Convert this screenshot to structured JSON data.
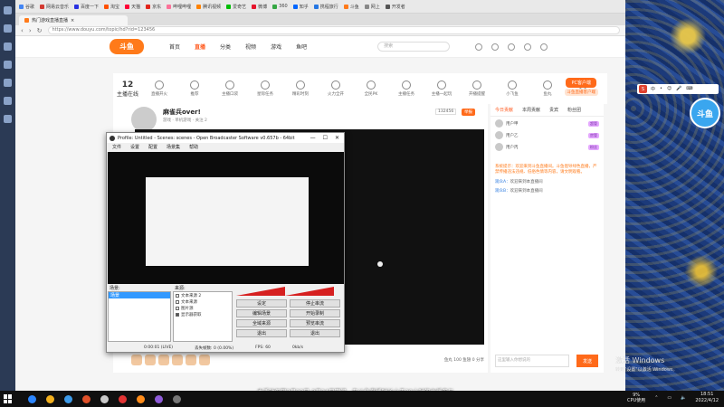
{
  "bookmarks": [
    {
      "label": "谷歌",
      "color": "#4285f4"
    },
    {
      "label": "网易云音乐",
      "color": "#d33a31"
    },
    {
      "label": "百度一下",
      "color": "#2932e1"
    },
    {
      "label": "淘宝",
      "color": "#ff5000"
    },
    {
      "label": "天猫",
      "color": "#ff0036"
    },
    {
      "label": "京东",
      "color": "#e1251b"
    },
    {
      "label": "哔哩哔哩",
      "color": "#fb7299"
    },
    {
      "label": "腾讯视频",
      "color": "#ff8200"
    },
    {
      "label": "爱奇艺",
      "color": "#00be06"
    },
    {
      "label": "微博",
      "color": "#e6162d"
    },
    {
      "label": "360",
      "color": "#35a743"
    },
    {
      "label": "知乎",
      "color": "#0066ff"
    },
    {
      "label": "携程旅行",
      "color": "#2577e3"
    },
    {
      "label": "斗鱼",
      "color": "#ff7a1a"
    },
    {
      "label": "网上",
      "color": "#888888"
    },
    {
      "label": "开发者",
      "color": "#555555"
    }
  ],
  "tab": {
    "title": "热门游戏直播直播"
  },
  "address": {
    "url": "https://www.douyu.com/topic/hd?rid=123456"
  },
  "site": {
    "logo": "斗鱼",
    "nav": [
      "首页",
      "直播",
      "分类",
      "视频",
      "游戏",
      "鱼吧"
    ],
    "active_nav": "直播",
    "search_placeholder": "搜索"
  },
  "category_strip": {
    "follow_count": "12",
    "follow_label": "主播在线",
    "items": [
      "直播开火",
      "推荐",
      "主播口袋",
      "星际任务",
      "精彩时刻",
      "火力全开",
      "全民PK",
      "主播任务",
      "主播一起玩",
      "开播提醒",
      "小飞鱼",
      "鱼丸",
      "更多"
    ],
    "pc_button": "PC客户端",
    "pc_sub": "斗鱼直播客户端"
  },
  "room": {
    "title": "麻雀兵over!",
    "meta": "游戏 · 单机游戏 · 关注 2",
    "room_id": "132456",
    "report": "举报",
    "gift_bar_text": "鱼丸 100  鱼翅 0  分享"
  },
  "chat": {
    "tabs": [
      "今日贡献",
      "本周贡献",
      "贵宾",
      "粉丝团"
    ],
    "active_tab": "今日贡献",
    "rank": [
      {
        "name": "用户甲",
        "badge": "超管"
      },
      {
        "name": "用户乙",
        "badge": "房管"
      },
      {
        "name": "用户丙",
        "badge": "粉丝"
      }
    ],
    "notice": "系统提示：欢迎来到斗鱼直播间。斗鱼倡导绿色直播，严禁传播违法违规、低俗色情等内容，请文明观看。",
    "lines": [
      {
        "user": "观众A",
        "text": "欢迎来到本直播间"
      },
      {
        "user": "观众B",
        "text": "欢迎来到本直播间"
      }
    ],
    "input_placeholder": "这里输入你想说的",
    "send": "发送"
  },
  "obs": {
    "title": "Profile: Untitled - Scenes: scenes - Open Broadcaster Software v0.657b - 64bit",
    "menu": [
      "文件",
      "设置",
      "配置",
      "场景集",
      "帮助"
    ],
    "scene_header": "场景:",
    "source_header": "来源:",
    "scenes": [
      "场景"
    ],
    "sources": [
      {
        "label": "文本来源 2",
        "checked": false
      },
      {
        "label": "文本来源",
        "checked": false
      },
      {
        "label": "图片源",
        "checked": false
      },
      {
        "label": "显示器获取",
        "checked": true
      }
    ],
    "buttons": [
      "设定",
      "停止串流",
      "编辑场景",
      "开始录制",
      "全域来源",
      "预览串流",
      "退出",
      "退出"
    ],
    "status": [
      "0:00:01 (LIVE)",
      "丢失帧数: 0 (0.00%)",
      "FPS: 60",
      "0kb/s"
    ]
  },
  "ime": {
    "logo": "S",
    "items": [
      "中",
      "•",
      "😊",
      "🎤",
      "⌨"
    ]
  },
  "side_logo": "斗鱼",
  "activation": {
    "title": "激活 Windows",
    "subtitle": "转到\"设置\"以激活 Windows。"
  },
  "subtitle": "本活动仅限2月22日-3月24日期间，在斗鱼直播时长小于20小时的主播参与",
  "taskbar": {
    "apps": [
      {
        "color": "#2c86ff"
      },
      {
        "color": "#f2b01e"
      },
      {
        "color": "#3d9be9"
      },
      {
        "color": "#e0512a"
      },
      {
        "color": "#c9c9c9"
      },
      {
        "color": "#e23434"
      },
      {
        "color": "#ff8c1a"
      },
      {
        "color": "#8e5bd8"
      },
      {
        "color": "#777777"
      }
    ],
    "cpu": "9%",
    "cpu_label": "CPU使用",
    "time": "18:51",
    "date": "2022/4/12"
  }
}
